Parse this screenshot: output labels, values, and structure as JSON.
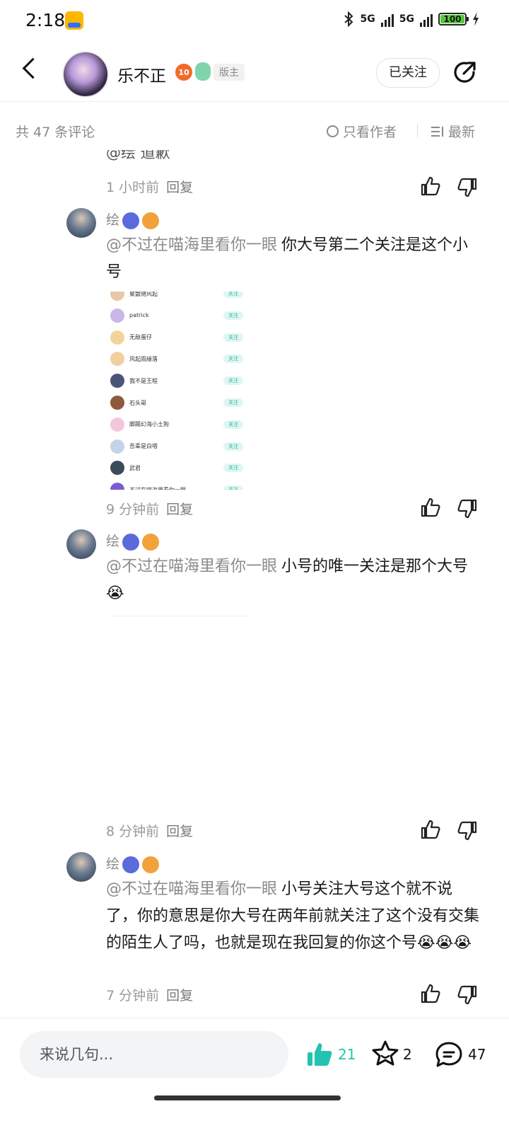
{
  "status_bar": {
    "time": "2:18",
    "net1": "5G",
    "net2": "5G",
    "battery": "100"
  },
  "header": {
    "username": "乐不正",
    "level": "10",
    "mod_badge": "版主",
    "follow_label": "已关注"
  },
  "sort_bar": {
    "count_label": "共 47 条评论",
    "author_only_label": "只看作者",
    "newest_label": "最新"
  },
  "comments": [
    {
      "clipped_text": "@绘  道歉",
      "time": "1 小时前",
      "reply_label": "回复"
    },
    {
      "name": "绘",
      "mention": "@不过在喵海里看你一眼",
      "text": "你大号第二个关注是这个小号",
      "time": "9 分钟前",
      "reply_label": "回复"
    },
    {
      "name": "绘",
      "mention": "@不过在喵海里看你一眼",
      "text": "小号的唯一关注是那个大号😭",
      "time": "8 分钟前",
      "reply_label": "回复"
    },
    {
      "name": "绘",
      "mention": "@不过在喵海里看你一眼",
      "text": "小号关注大号这个就不说了，你的意思是你大号在两年前就关注了这个没有交集的陌生人了吗，也就是现在我回复的你这个号😭😭😭",
      "time": "7 分钟前",
      "reply_label": "回复"
    }
  ],
  "screenshot_list": {
    "follow_label": "关注",
    "rows": [
      "聚散随风起",
      "patrick",
      "无敌蛋仔",
      "风起雨緣落",
      "我不是王程",
      "石头哥",
      "脚踢幻海小土狗",
      "吾辈是白嗒",
      "武君",
      "不过在喵海里看你一眼"
    ]
  },
  "bottom_bar": {
    "input_placeholder": "来说几句...",
    "likes": "21",
    "stars": "2",
    "comments": "47"
  },
  "colors": {
    "accent": "#22c3b0",
    "muted": "#8a8a8a"
  }
}
